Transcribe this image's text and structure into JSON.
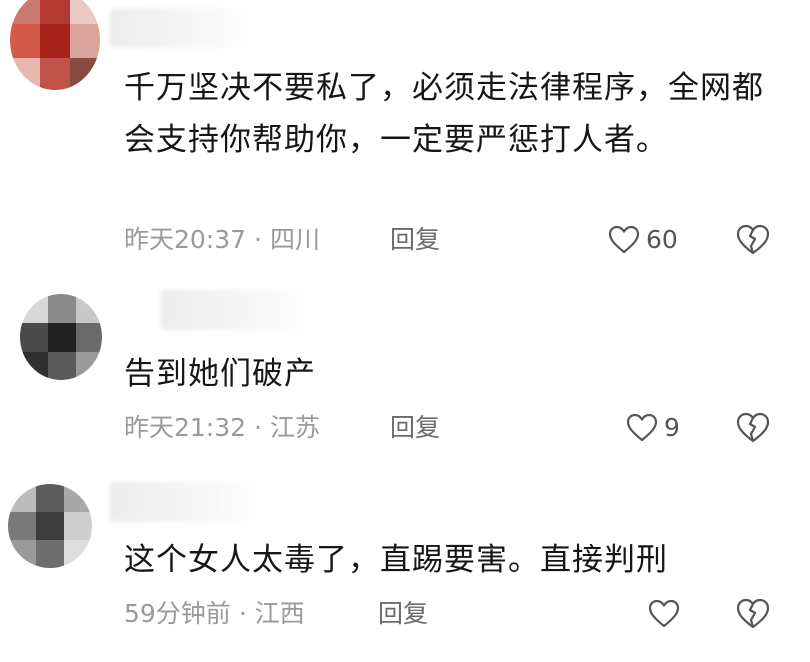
{
  "comments": [
    {
      "text": "千万坚决不要私了，必须走法律程序，全网都会支持你帮助你，一定要严惩打人者。",
      "time": "昨天20:37",
      "location": "四川",
      "reply_label": "回复",
      "likes": "60",
      "dislike_icon": "broken-heart-icon"
    },
    {
      "text": "告到她们破产",
      "time": "昨天21:32",
      "location": "江苏",
      "reply_label": "回复",
      "likes": "9",
      "dislike_icon": "broken-heart-icon"
    },
    {
      "text": "这个女人太毒了，直踢要害。直接判刑",
      "time": "59分钟前",
      "location": "江西",
      "reply_label": "回复",
      "likes": "",
      "dislike_icon": "broken-heart-icon"
    }
  ],
  "meta_separator": "·",
  "icons": {
    "like": "heart-outline-icon",
    "dislike": "broken-heart-icon"
  },
  "colors": {
    "text": "#161616",
    "meta": "#9a9a9a",
    "icon": "#555555"
  }
}
